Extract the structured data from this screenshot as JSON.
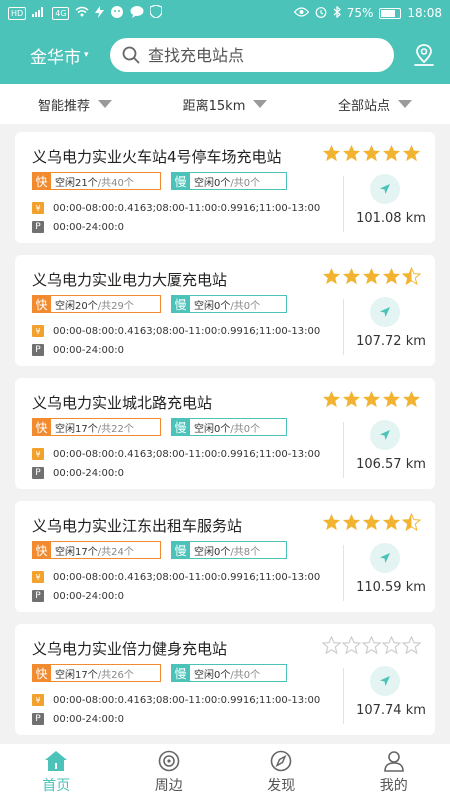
{
  "status_bar": {
    "network_tags": [
      "HD",
      "4G"
    ],
    "battery_text": "75%",
    "battery_level": 0.75,
    "time": "18:08"
  },
  "header": {
    "city": "金华市",
    "search_placeholder": "查找充电站点"
  },
  "filters": [
    {
      "label": "智能推荐"
    },
    {
      "label": "距离15km"
    },
    {
      "label": "全部站点"
    }
  ],
  "stations": [
    {
      "name": "义乌电力实业火车站4号停车场充电站",
      "rating": 5,
      "fast_type": "快",
      "fast_free": "空闲21个",
      "fast_total": "/共40个",
      "slow_type": "慢",
      "slow_free": "空闲0个",
      "slow_total": "/共0个",
      "price_icon": "¥",
      "price_periods": "00:00-08:00:0.4163;08:00-11:00:0.9916;11:00-13:00",
      "park_icon": "P",
      "park_hours": "00:00-24:00:0",
      "distance": "101.08 km"
    },
    {
      "name": "义乌电力实业电力大厦充电站",
      "rating": 4.5,
      "fast_type": "快",
      "fast_free": "空闲20个",
      "fast_total": "/共29个",
      "slow_type": "慢",
      "slow_free": "空闲0个",
      "slow_total": "/共0个",
      "price_icon": "¥",
      "price_periods": "00:00-08:00:0.4163;08:00-11:00:0.9916;11:00-13:00",
      "park_icon": "P",
      "park_hours": "00:00-24:00:0",
      "distance": "107.72 km"
    },
    {
      "name": "义乌电力实业城北路充电站",
      "rating": 5,
      "fast_type": "快",
      "fast_free": "空闲17个",
      "fast_total": "/共22个",
      "slow_type": "慢",
      "slow_free": "空闲0个",
      "slow_total": "/共0个",
      "price_icon": "¥",
      "price_periods": "00:00-08:00:0.4163;08:00-11:00:0.9916;11:00-13:00",
      "park_icon": "P",
      "park_hours": "00:00-24:00:0",
      "distance": "106.57 km"
    },
    {
      "name": "义乌电力实业江东出租车服务站",
      "rating": 4.5,
      "fast_type": "快",
      "fast_free": "空闲17个",
      "fast_total": "/共24个",
      "slow_type": "慢",
      "slow_free": "空闲0个",
      "slow_total": "/共8个",
      "price_icon": "¥",
      "price_periods": "00:00-08:00:0.4163;08:00-11:00:0.9916;11:00-13:00",
      "park_icon": "P",
      "park_hours": "00:00-24:00:0",
      "distance": "110.59 km"
    },
    {
      "name": "义乌电力实业倍力健身充电站",
      "rating": 0,
      "fast_type": "快",
      "fast_free": "空闲17个",
      "fast_total": "/共26个",
      "slow_type": "慢",
      "slow_free": "空闲0个",
      "slow_total": "/共0个",
      "price_icon": "¥",
      "price_periods": "00:00-08:00:0.4163;08:00-11:00:0.9916;11:00-13:00",
      "park_icon": "P",
      "park_hours": "00:00-24:00:0",
      "distance": "107.74 km"
    }
  ],
  "tabs": [
    {
      "label": "首页",
      "icon": "home-icon",
      "active": true
    },
    {
      "label": "周边",
      "icon": "target-icon",
      "active": false
    },
    {
      "label": "发现",
      "icon": "compass-icon",
      "active": false
    },
    {
      "label": "我的",
      "icon": "user-icon",
      "active": false
    }
  ],
  "colors": {
    "accent": "#4bc3b9",
    "fast": "#f28b30",
    "star": "#f2b430",
    "star_empty": "#cccccc"
  }
}
